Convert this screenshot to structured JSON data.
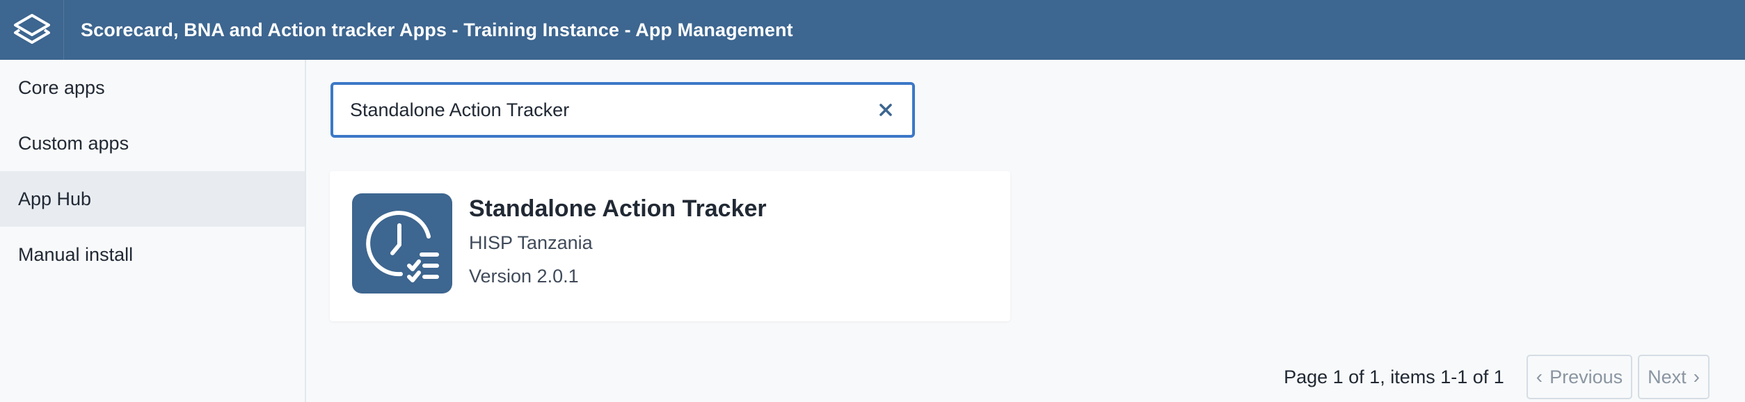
{
  "header": {
    "title": "Scorecard, BNA and Action tracker Apps - Training Instance - App Management",
    "logo_icon": "dhis2-logo-icon"
  },
  "sidebar": {
    "items": [
      {
        "label": "Core apps",
        "active": false
      },
      {
        "label": "Custom apps",
        "active": false
      },
      {
        "label": "App Hub",
        "active": true
      },
      {
        "label": "Manual install",
        "active": false
      }
    ]
  },
  "search": {
    "value": "Standalone Action Tracker",
    "clear_icon": "close-icon"
  },
  "results": [
    {
      "name": "Standalone Action Tracker",
      "developer": "HISP Tanzania",
      "version": "Version 2.0.1",
      "icon": "clock-checklist-icon"
    }
  ],
  "pagination": {
    "summary": "Page 1 of 1, items 1-1 of 1",
    "previous_label": "Previous",
    "next_label": "Next"
  },
  "colors": {
    "header_bg": "#3d6690",
    "accent": "#3c78c7",
    "active_item_bg": "#e8ecf1"
  }
}
